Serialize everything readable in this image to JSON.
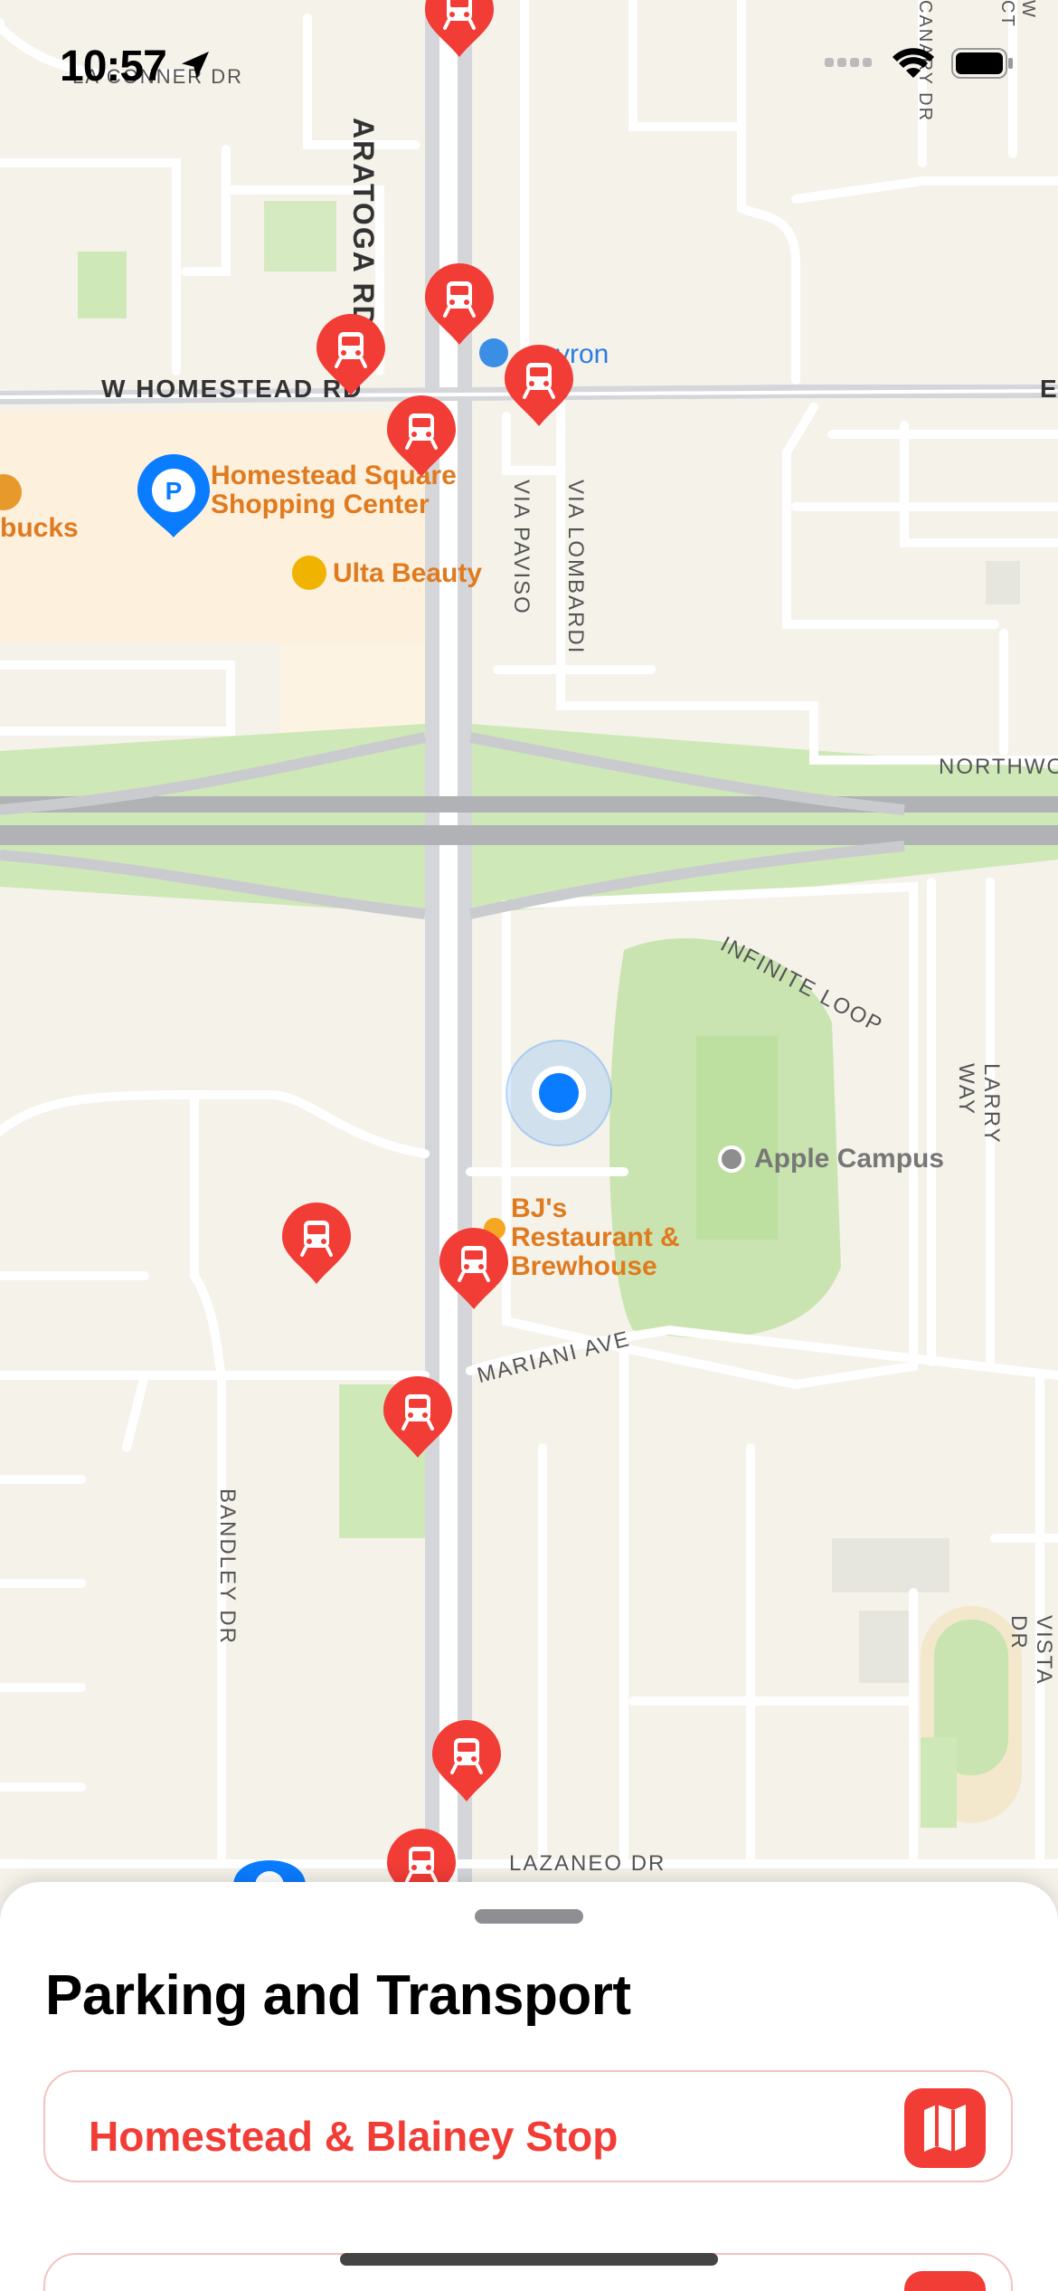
{
  "status_bar": {
    "time": "10:57",
    "icons": [
      "location-arrow-icon",
      "signal-icon",
      "wifi-icon",
      "battery-icon"
    ]
  },
  "map": {
    "places": {
      "homestead_square": "Homestead Square\nShopping Center",
      "ulta": "Ulta Beauty",
      "bjs": "BJ's\nRestaurant &\nBrewhouse",
      "apple": "Apple Campus",
      "chevron": "vron",
      "starbucks": "bucks"
    },
    "streets": {
      "la_conner": "LA CONNER DR",
      "saratoga": "ARATOGA RD",
      "w_homestead": "W HOMESTEAD RD",
      "via_paviso": "VIA PAVISO",
      "via_lombardi": "VIA LOMBARDI",
      "northwood": "NORTHWO",
      "infinite_loop": "INFINITE LOOP",
      "larry_way": "LARRY WAY",
      "mariani": "MARIANI AVE",
      "bandley": "BANDLEY DR",
      "lazaneo": "LAZANEO DR",
      "vista": "VISTA DR",
      "canary": "CANARY DR",
      "w_ct": "W CT",
      "e": "E"
    },
    "colors": {
      "transit_pin": "#f23c36",
      "parking_pin": "#0a7cff",
      "poi_label": "#e07a1f",
      "user_location": "#0a7cff"
    }
  },
  "sheet": {
    "title": "Parking and Transport",
    "items": [
      {
        "label": "Homestead & Blainey Stop",
        "icon": "map-icon"
      },
      {
        "label": "",
        "icon": "map-icon"
      }
    ]
  }
}
